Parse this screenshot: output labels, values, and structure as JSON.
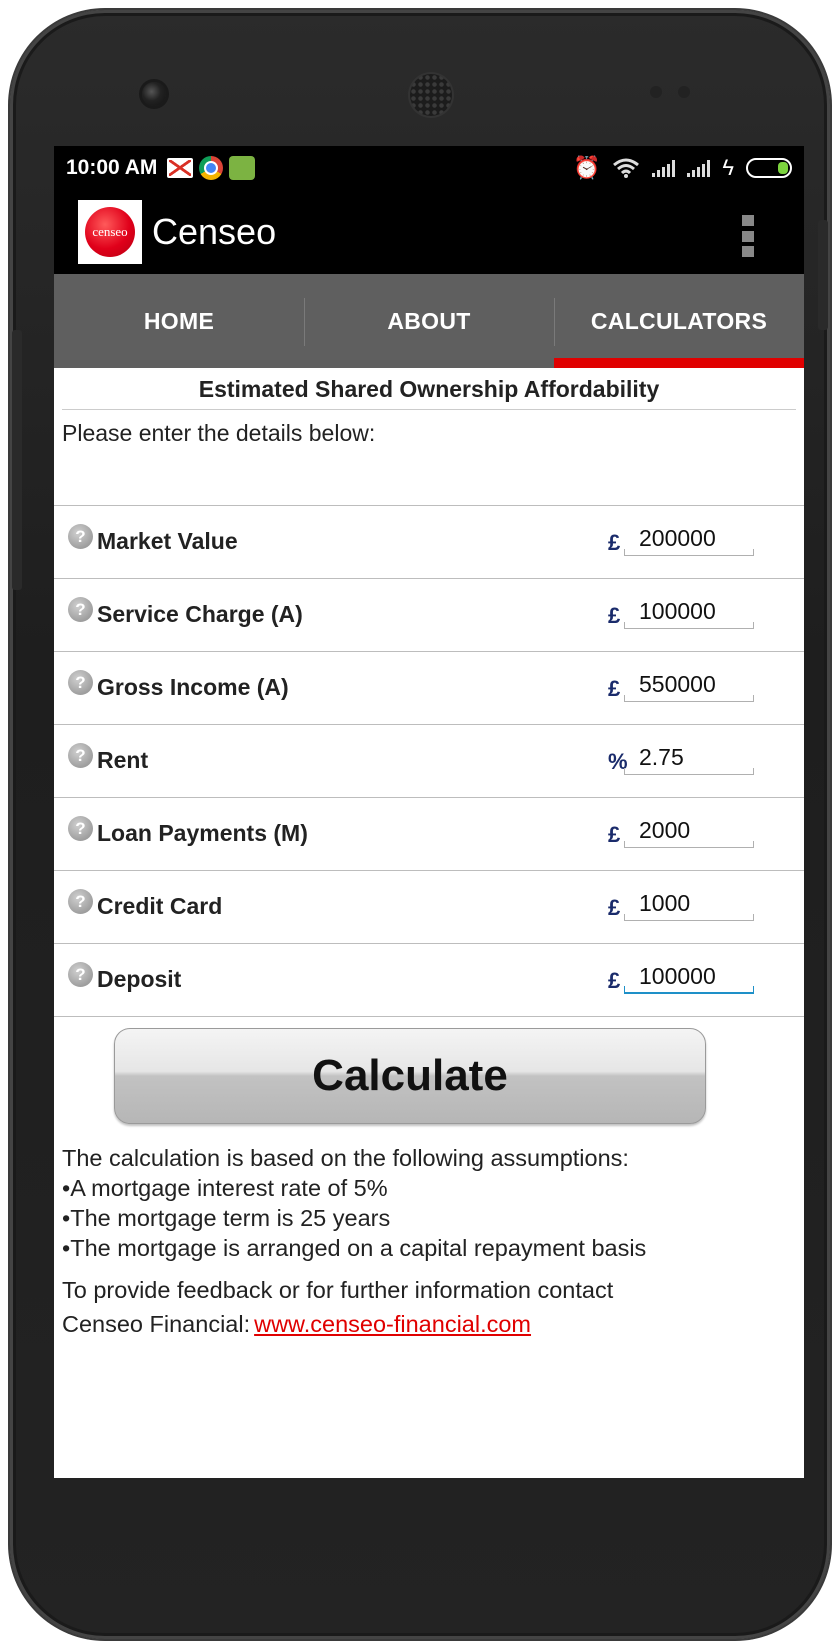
{
  "status_bar": {
    "time": "10:00 AM",
    "icons": [
      "gmail-icon",
      "chrome-icon",
      "android-icon",
      "alarm-icon",
      "wifi-icon",
      "signal-icon",
      "signal-icon",
      "charging-icon",
      "battery-icon"
    ],
    "battery_color": "#7cd33e"
  },
  "app_bar": {
    "logo_text": "censeo",
    "title": "Censeo",
    "overflow_icon": "more-vert-icon"
  },
  "tabs": [
    {
      "label": "HOME",
      "active": false
    },
    {
      "label": "ABOUT",
      "active": false
    },
    {
      "label": "CALCULATORS",
      "active": true
    }
  ],
  "accent_color": "#e00000",
  "calculator": {
    "title": "Estimated Shared Ownership Affordability",
    "intro": "Please enter the details below:",
    "fields": [
      {
        "label": "Market Value",
        "unit": "£",
        "value": "200000"
      },
      {
        "label": "Service Charge (A)",
        "unit": "£",
        "value": "100000"
      },
      {
        "label": "Gross Income (A)",
        "unit": "£",
        "value": "550000"
      },
      {
        "label": "Rent",
        "unit": "%",
        "value": "2.75"
      },
      {
        "label": "Loan Payments (M)",
        "unit": "£",
        "value": "2000"
      },
      {
        "label": "Credit Card",
        "unit": "£",
        "value": "1000"
      },
      {
        "label": "Deposit",
        "unit": "£",
        "value": "100000",
        "focused": true
      }
    ],
    "calculate_label": "Calculate"
  },
  "notes": {
    "heading": "The calculation is based on the following assumptions:",
    "bullets": [
      "•A mortgage interest rate of 5%",
      "•The mortgage term is 25 years",
      "•The mortgage is arranged on a capital repayment basis"
    ],
    "feedback_line1": "To provide feedback or for further information contact",
    "feedback_line2": "Censeo Financial:",
    "link_text": "www.censeo-financial.com"
  }
}
